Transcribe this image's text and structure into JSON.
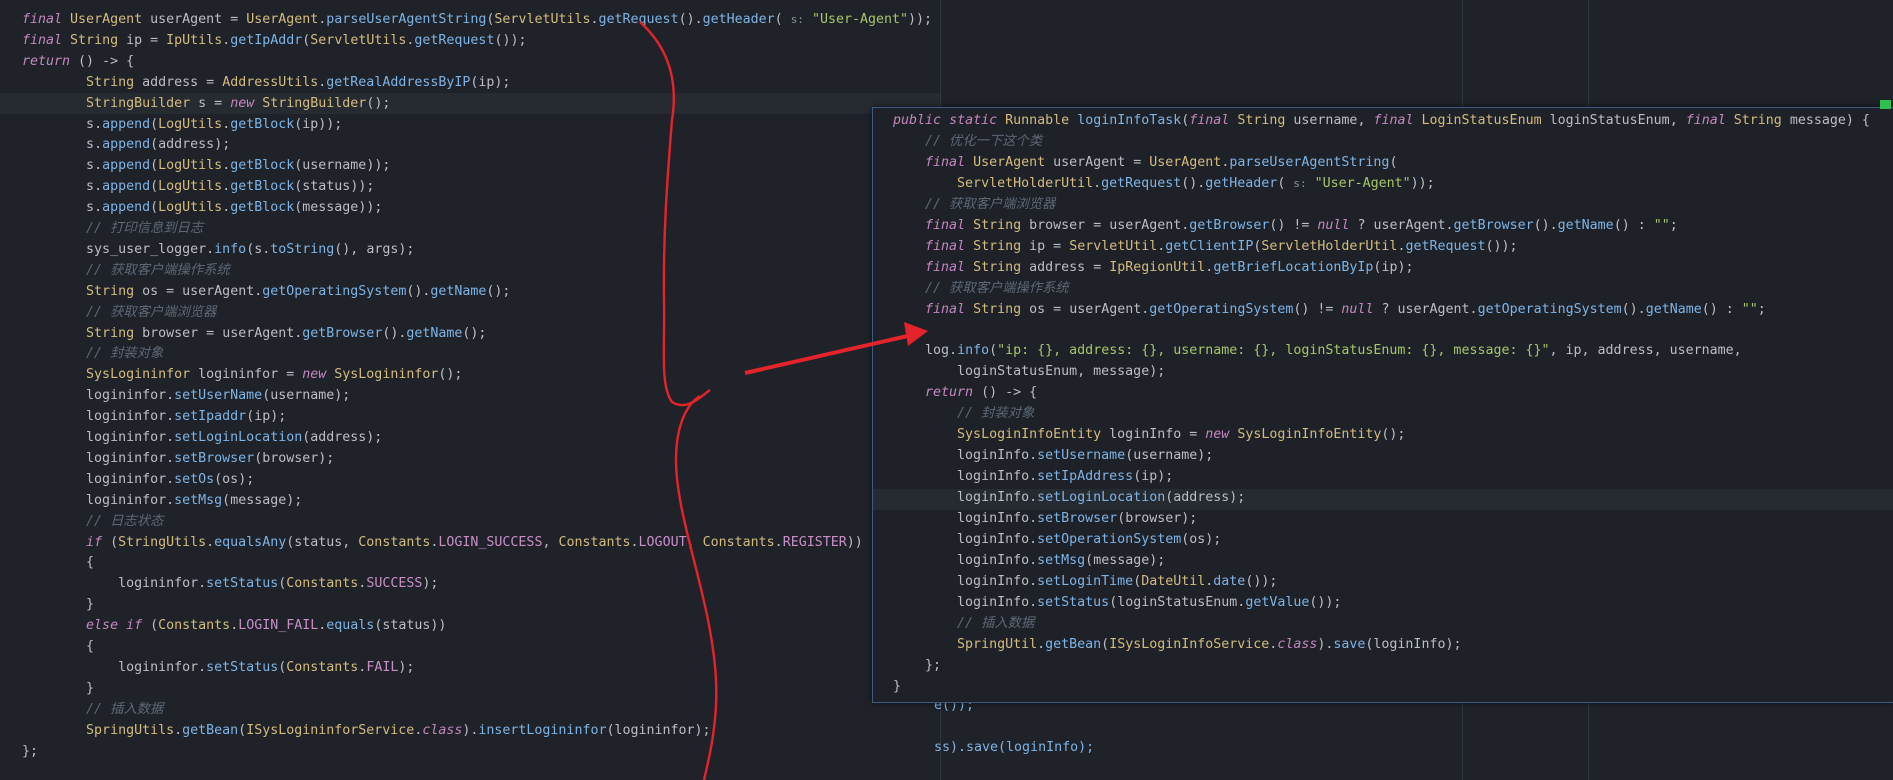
{
  "hint_label": "s:",
  "left_code": [
    [
      "final UserAgent userAgent = UserAgent.parseUserAgentString(ServletUtils.getRequest().getHeader( ",
      "\"User-Agent\"));"
    ],
    [
      "final String ip = IpUtils.getIpAddr(ServletUtils.getRequest());"
    ],
    [
      "return () -> {"
    ],
    [
      "        String address = AddressUtils.getRealAddressByIP(ip);"
    ],
    [
      "        StringBuilder s = new StringBuilder();"
    ],
    [
      "        s.append(LogUtils.getBlock(ip));"
    ],
    [
      "        s.append(address);"
    ],
    [
      "        s.append(LogUtils.getBlock(username));"
    ],
    [
      "        s.append(LogUtils.getBlock(status));"
    ],
    [
      "        s.append(LogUtils.getBlock(message));"
    ],
    [
      "        // 打印信息到日志"
    ],
    [
      "        sys_user_logger.info(s.toString(), args);"
    ],
    [
      "        // 获取客户端操作系统"
    ],
    [
      "        String os = userAgent.getOperatingSystem().getName();"
    ],
    [
      "        // 获取客户端浏览器"
    ],
    [
      "        String browser = userAgent.getBrowser().getName();"
    ],
    [
      "        // 封装对象"
    ],
    [
      "        SysLogininfor logininfor = new SysLogininfor();"
    ],
    [
      "        logininfor.setUserName(username);"
    ],
    [
      "        logininfor.setIpaddr(ip);"
    ],
    [
      "        logininfor.setLoginLocation(address);"
    ],
    [
      "        logininfor.setBrowser(browser);"
    ],
    [
      "        logininfor.setOs(os);"
    ],
    [
      "        logininfor.setMsg(message);"
    ],
    [
      "        // 日志状态"
    ],
    [
      "        if (StringUtils.equalsAny(status, Constants.LOGIN_SUCCESS, Constants.LOGOUT, Constants.REGISTER))"
    ],
    [
      "        {"
    ],
    [
      "            logininfor.setStatus(Constants.SUCCESS);"
    ],
    [
      "        }"
    ],
    [
      "        else if (Constants.LOGIN_FAIL.equals(status))"
    ],
    [
      "        {"
    ],
    [
      "            logininfor.setStatus(Constants.FAIL);"
    ],
    [
      "        }"
    ],
    [
      "        // 插入数据"
    ],
    [
      "        SpringUtils.getBean(ISysLogininforService.class).insertLogininfor(logininfor);"
    ],
    [
      "};"
    ]
  ],
  "behind_fragments": [
    "e());",
    "ss).save(loginInfo);"
  ],
  "popup_code": [
    [
      "public static Runnable loginInfoTask(final String username, final LoginStatusEnum loginStatusEnum, final String message) {"
    ],
    [
      "    // 优化一下这个类"
    ],
    [
      "    final UserAgent userAgent = UserAgent.parseUserAgentString("
    ],
    [
      "        ServletHolderUtil.getRequest().getHeader( ",
      "\"User-Agent\"));"
    ],
    [
      "    // 获取客户端浏览器"
    ],
    [
      "    final String browser = userAgent.getBrowser() != null ? userAgent.getBrowser().getName() : \"\";"
    ],
    [
      "    final String ip = ServletUtil.getClientIP(ServletHolderUtil.getRequest());"
    ],
    [
      "    final String address = IpRegionUtil.getBriefLocationByIp(ip);"
    ],
    [
      "    // 获取客户端操作系统"
    ],
    [
      "    final String os = userAgent.getOperatingSystem() != null ? userAgent.getOperatingSystem().getName() : \"\";"
    ],
    [
      ""
    ],
    [
      "    log.info(\"ip: {}, address: {}, username: {}, loginStatusEnum: {}, message: {}\", ip, address, username,"
    ],
    [
      "        loginStatusEnum, message);"
    ],
    [
      "    return () -> {"
    ],
    [
      "        // 封装对象"
    ],
    [
      "        SysLoginInfoEntity loginInfo = new SysLoginInfoEntity();"
    ],
    [
      "        loginInfo.setUsername(username);"
    ],
    [
      "        loginInfo.setIpAddress(ip);"
    ],
    [
      "        loginInfo.setLoginLocation(address);"
    ],
    [
      "        loginInfo.setBrowser(browser);"
    ],
    [
      "        loginInfo.setOperationSystem(os);"
    ],
    [
      "        loginInfo.setMsg(message);"
    ],
    [
      "        loginInfo.setLoginTime(DateUtil.date());"
    ],
    [
      "        loginInfo.setStatus(loginStatusEnum.getValue());"
    ],
    [
      "        // 插入数据"
    ],
    [
      "        SpringUtil.getBean(ISysLoginInfoService.class).save(loginInfo);"
    ],
    [
      "    };"
    ],
    [
      "}"
    ]
  ],
  "colors": {
    "background": "#1f2329",
    "annotation": "#e5232b",
    "popup_border": "#3c5a82"
  }
}
